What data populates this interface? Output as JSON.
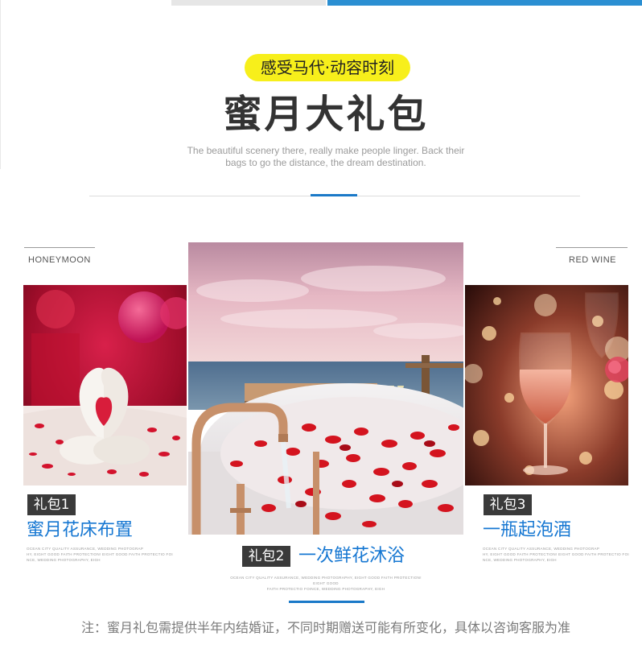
{
  "header": {
    "tagline": "感受马代·动容时刻",
    "title": "蜜月大礼包",
    "subtitle_line1": "The beautiful scenery there, really make people linger. Back their",
    "subtitle_line2": "bags to go the distance, the dream destination."
  },
  "side_labels": {
    "left": "HONEYMOON",
    "right": "RED WINE"
  },
  "gifts": [
    {
      "badge": "礼包1",
      "title": "蜜月花床布置",
      "fine_lines": [
        "OCEAN CITY QUALITY ASSURANCE, WEDDING PHOTOGRAP",
        "HY, EIGHT GOOD FAITH PROTECTION! EIGHT GOOD FAITH PROTECTIO FOI",
        "NCE, WEDDING PHOTOGRAPHY, EIGH"
      ]
    },
    {
      "badge": "礼包2",
      "title": "一次鲜花沐浴",
      "fine_lines": [
        "OCEAN CITY QUALITY ASSURANCE, WEDDING PHOTOGRAPHY, EIGHT GOOD FAITH PROTECTION! EIGHT GOOD",
        "FAITH PROTECTIO FOINCE, WEDDING PHOTOGRAPHY, EIGH"
      ]
    },
    {
      "badge": "礼包3",
      "title": "一瓶起泡酒",
      "fine_lines": [
        "OCEAN CITY QUALITY ASSURANCE, WEDDING PHOTOGRAP",
        "HY, EIGHT GOOD FAITH PROTECTION! EIGHT GOOD FAITH PROTECTIO FOI",
        "NCE, WEDDING PHOTOGRAPHY, EIGH"
      ]
    }
  ],
  "photos": {
    "left": "towel-swan-heart-photo",
    "center": "rose-petal-bath-sea-view-photo",
    "right": "sparkling-wine-glass-photo"
  },
  "note": "注：蜜月礼包需提供半年内结婚证，不同时期赠送可能有所变化，具体以咨询客服为准",
  "colors": {
    "accent_blue": "#1677d2",
    "tagline_yellow": "#f7ef1b",
    "badge_dark": "#3a3a3a"
  }
}
